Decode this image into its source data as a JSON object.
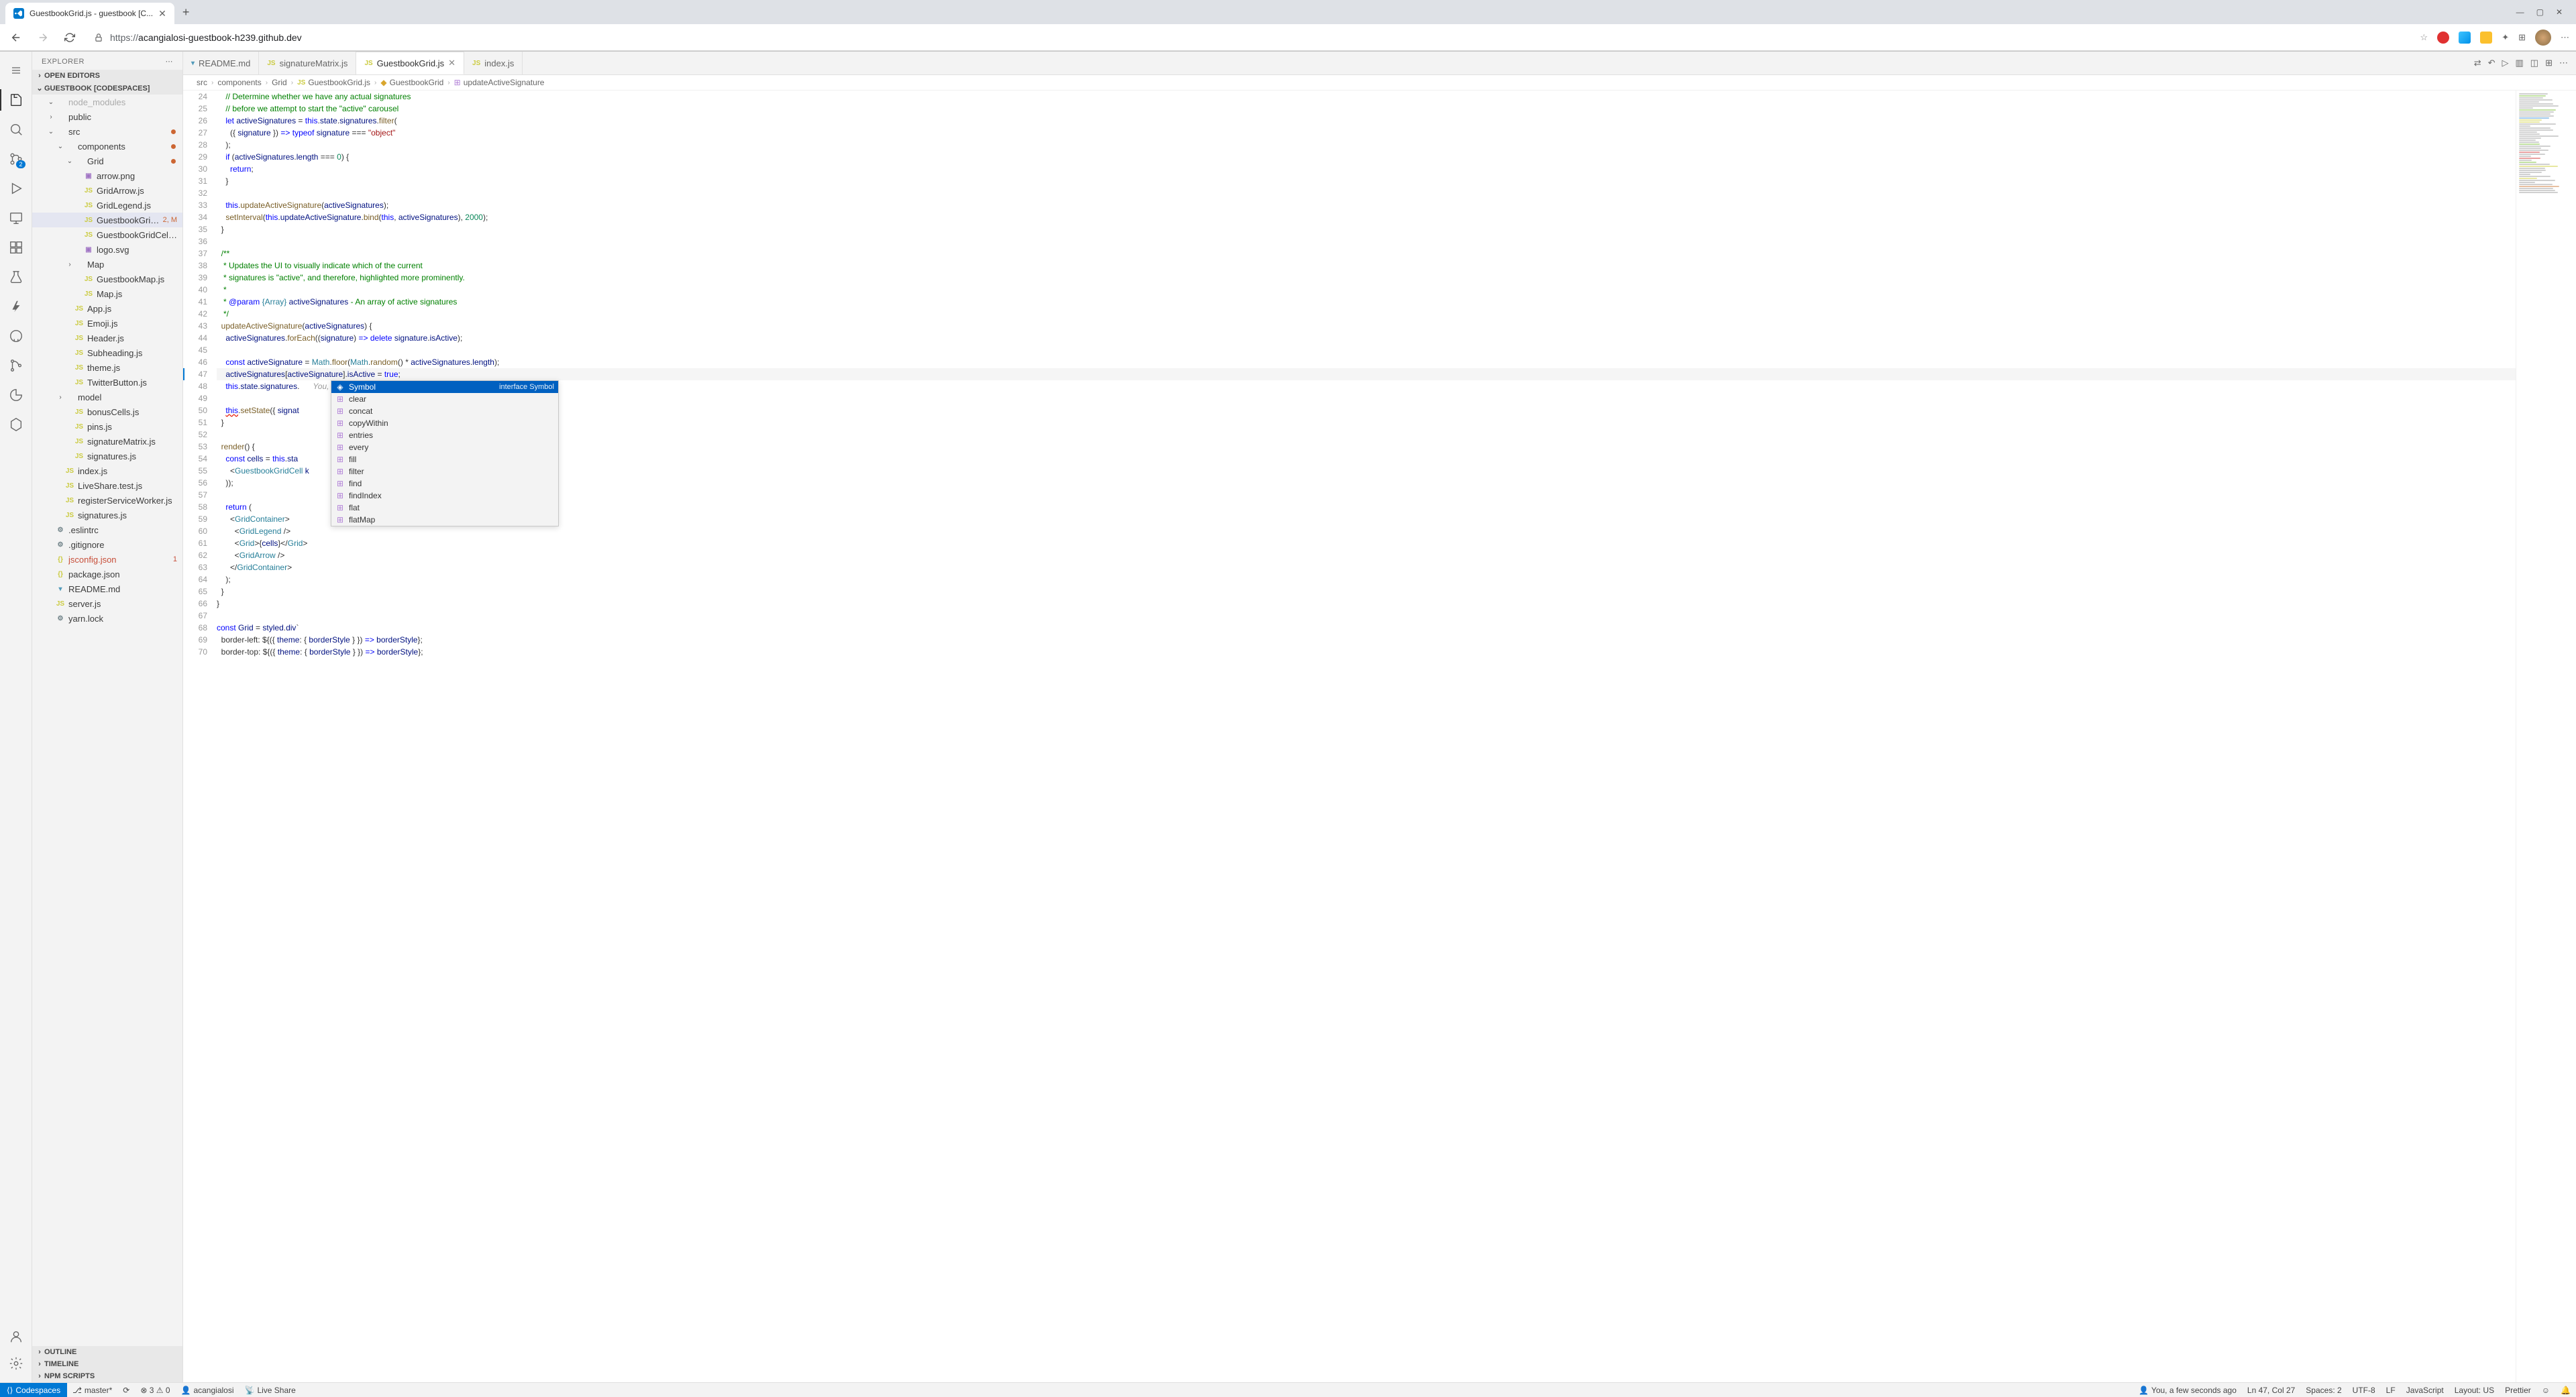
{
  "browser": {
    "tab_title": "GuestbookGrid.js - guestbook [C...",
    "url_protocol": "https://",
    "url_host": "acangialosi-guestbook-h239.github.dev"
  },
  "window_controls": {
    "min": "—",
    "max": "▢",
    "close": "✕"
  },
  "sidebar": {
    "title": "EXPLORER",
    "sections": {
      "open_editors": "OPEN EDITORS",
      "workspace": "GUESTBOOK [CODESPACES]",
      "outline": "OUTLINE",
      "timeline": "TIMELINE",
      "npm": "NPM SCRIPTS"
    },
    "tree": [
      {
        "depth": 1,
        "type": "folder-open-dim",
        "label": "node_modules",
        "dim": true
      },
      {
        "depth": 1,
        "type": "folder",
        "label": "public"
      },
      {
        "depth": 1,
        "type": "folder-open",
        "label": "src",
        "dot": "#cc6633"
      },
      {
        "depth": 2,
        "type": "folder-open",
        "label": "components",
        "dot": "#cc6633"
      },
      {
        "depth": 3,
        "type": "folder-open",
        "label": "Grid",
        "dot": "#cc6633"
      },
      {
        "depth": 4,
        "type": "file",
        "icon": "img",
        "label": "arrow.png",
        "color": "#a074c4"
      },
      {
        "depth": 4,
        "type": "file",
        "icon": "js",
        "label": "GridArrow.js",
        "color": "#cbcb41"
      },
      {
        "depth": 4,
        "type": "file",
        "icon": "js",
        "label": "GridLegend.js",
        "color": "#cbcb41"
      },
      {
        "depth": 4,
        "type": "file",
        "icon": "js",
        "label": "GuestbookGrid.js",
        "color": "#cbcb41",
        "selected": true,
        "decor": "2, M",
        "decorColor": "#cc6633"
      },
      {
        "depth": 4,
        "type": "file",
        "icon": "js",
        "label": "GuestbookGridCell.js",
        "color": "#cbcb41"
      },
      {
        "depth": 4,
        "type": "file",
        "icon": "img",
        "label": "logo.svg",
        "color": "#a074c4"
      },
      {
        "depth": 3,
        "type": "folder",
        "label": "Map"
      },
      {
        "depth": 4,
        "type": "file",
        "icon": "js",
        "label": "GuestbookMap.js",
        "color": "#cbcb41"
      },
      {
        "depth": 4,
        "type": "file",
        "icon": "js",
        "label": "Map.js",
        "color": "#cbcb41"
      },
      {
        "depth": 3,
        "type": "file",
        "icon": "js",
        "label": "App.js",
        "color": "#cbcb41"
      },
      {
        "depth": 3,
        "type": "file",
        "icon": "js",
        "label": "Emoji.js",
        "color": "#cbcb41"
      },
      {
        "depth": 3,
        "type": "file",
        "icon": "js",
        "label": "Header.js",
        "color": "#cbcb41"
      },
      {
        "depth": 3,
        "type": "file",
        "icon": "js",
        "label": "Subheading.js",
        "color": "#cbcb41"
      },
      {
        "depth": 3,
        "type": "file",
        "icon": "js",
        "label": "theme.js",
        "color": "#cbcb41"
      },
      {
        "depth": 3,
        "type": "file",
        "icon": "js",
        "label": "TwitterButton.js",
        "color": "#cbcb41"
      },
      {
        "depth": 2,
        "type": "folder",
        "label": "model"
      },
      {
        "depth": 3,
        "type": "file",
        "icon": "js",
        "label": "bonusCells.js",
        "color": "#cbcb41"
      },
      {
        "depth": 3,
        "type": "file",
        "icon": "js",
        "label": "pins.js",
        "color": "#cbcb41"
      },
      {
        "depth": 3,
        "type": "file",
        "icon": "js",
        "label": "signatureMatrix.js",
        "color": "#cbcb41"
      },
      {
        "depth": 3,
        "type": "file",
        "icon": "js",
        "label": "signatures.js",
        "color": "#cbcb41"
      },
      {
        "depth": 2,
        "type": "file",
        "icon": "js",
        "label": "index.js",
        "color": "#cbcb41"
      },
      {
        "depth": 2,
        "type": "file",
        "icon": "js",
        "label": "LiveShare.test.js",
        "color": "#cbcb41"
      },
      {
        "depth": 2,
        "type": "file",
        "icon": "js",
        "label": "registerServiceWorker.js",
        "color": "#cbcb41"
      },
      {
        "depth": 2,
        "type": "file",
        "icon": "js",
        "label": "signatures.js",
        "color": "#cbcb41"
      },
      {
        "depth": 1,
        "type": "file",
        "icon": "cfg",
        "label": ".eslintrc",
        "color": "#6d8086"
      },
      {
        "depth": 1,
        "type": "file",
        "icon": "cfg",
        "label": ".gitignore",
        "color": "#6d8086"
      },
      {
        "depth": 1,
        "type": "file",
        "icon": "json",
        "label": "jsconfig.json",
        "color": "#cbcb41",
        "decor": "1",
        "decorColor": "#c74e39",
        "labelColor": "#c74e39"
      },
      {
        "depth": 1,
        "type": "file",
        "icon": "json",
        "label": "package.json",
        "color": "#cbcb41"
      },
      {
        "depth": 1,
        "type": "file",
        "icon": "md",
        "label": "README.md",
        "color": "#519aba"
      },
      {
        "depth": 1,
        "type": "file",
        "icon": "js",
        "label": "server.js",
        "color": "#cbcb41"
      },
      {
        "depth": 1,
        "type": "file",
        "icon": "cfg",
        "label": "yarn.lock",
        "color": "#6d8086"
      }
    ]
  },
  "editor": {
    "tabs": [
      {
        "icon": "md",
        "label": "README.md",
        "color": "#519aba"
      },
      {
        "icon": "js",
        "label": "signatureMatrix.js",
        "color": "#cbcb41"
      },
      {
        "icon": "js",
        "label": "GuestbookGrid.js",
        "color": "#cbcb41",
        "active": true,
        "close": true
      },
      {
        "icon": "js",
        "label": "index.js",
        "color": "#cbcb41"
      }
    ],
    "breadcrumbs": [
      {
        "label": "src"
      },
      {
        "label": "components"
      },
      {
        "label": "Grid"
      },
      {
        "icon": "js",
        "label": "GuestbookGrid.js",
        "color": "#cbcb41"
      },
      {
        "icon": "class",
        "label": "GuestbookGrid",
        "color": "#d9a62e"
      },
      {
        "icon": "method",
        "label": "updateActiveSignature",
        "color": "#b180d7"
      }
    ],
    "code_start_line": 24,
    "suggest": {
      "items": [
        {
          "icon": "◈",
          "label": "Symbol",
          "detail": "interface Symbol",
          "sel": true
        },
        {
          "icon": "⊞",
          "label": "clear"
        },
        {
          "icon": "⊞",
          "label": "concat"
        },
        {
          "icon": "⊞",
          "label": "copyWithin"
        },
        {
          "icon": "⊞",
          "label": "entries"
        },
        {
          "icon": "⊞",
          "label": "every"
        },
        {
          "icon": "⊞",
          "label": "fill"
        },
        {
          "icon": "⊞",
          "label": "filter"
        },
        {
          "icon": "⊞",
          "label": "find"
        },
        {
          "icon": "⊞",
          "label": "findIndex"
        },
        {
          "icon": "⊞",
          "label": "flat"
        },
        {
          "icon": "⊞",
          "label": "flatMap"
        }
      ]
    },
    "inline_hint": "You, a few seconds ago • Uncommitted changes"
  },
  "status": {
    "codespaces": "Codespaces",
    "branch": "master*",
    "sync": "⟳",
    "errors": "⊗ 3  ⚠ 0",
    "user": "acangialosi",
    "liveshare": "Live Share",
    "blame": "You, a few seconds ago",
    "cursor": "Ln 47, Col 27",
    "spaces": "Spaces: 2",
    "encoding": "UTF-8",
    "eol": "LF",
    "lang": "JavaScript",
    "layout": "Layout: US",
    "prettier": "Prettier",
    "feedback": "☺",
    "bell": "🔔"
  }
}
